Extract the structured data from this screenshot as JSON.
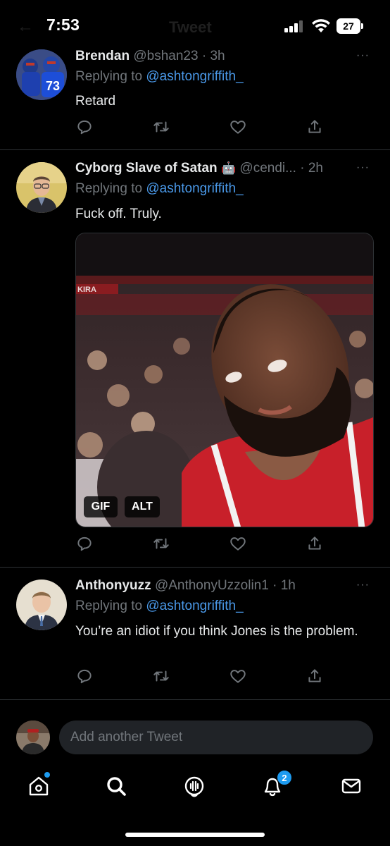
{
  "status_bar": {
    "time": "7:53",
    "battery": "27"
  },
  "header": {
    "title": "Tweet"
  },
  "tweets": [
    {
      "name": "Brendan",
      "handle": "@bshan23",
      "time": "· 3h",
      "replying_label": "Replying to",
      "replying_to": "@ashtongriffith_",
      "text": "Retard",
      "more": "···"
    },
    {
      "name": "Cyborg Slave of Satan",
      "name_emoji": "🤖",
      "handle": "@cendi...",
      "time": "· 2h",
      "replying_label": "Replying to",
      "replying_to": "@ashtongriffith_",
      "text": "Fuck off. Truly.",
      "more": "···",
      "media": {
        "badges": [
          "GIF",
          "ALT"
        ],
        "arena_sign": "KIRA"
      }
    },
    {
      "name": "Anthonyuzz",
      "handle": "@AnthonyUzzolin1",
      "time": "· 1h",
      "replying_label": "Replying to",
      "replying_to": "@ashtongriffith_",
      "text": "You’re an idiot if you think Jones is the problem.",
      "more": "···"
    }
  ],
  "composer": {
    "placeholder": "Add another Tweet"
  },
  "tabbar": {
    "items": [
      "home-icon",
      "search-icon",
      "spaces-icon",
      "notifications-icon",
      "messages-icon"
    ],
    "notification_count": "2"
  },
  "colors": {
    "background": "#000000",
    "accent": "#1d9bf0",
    "mention": "#4a99e9",
    "secondary_text": "#71767b",
    "divider": "#2f3336"
  }
}
